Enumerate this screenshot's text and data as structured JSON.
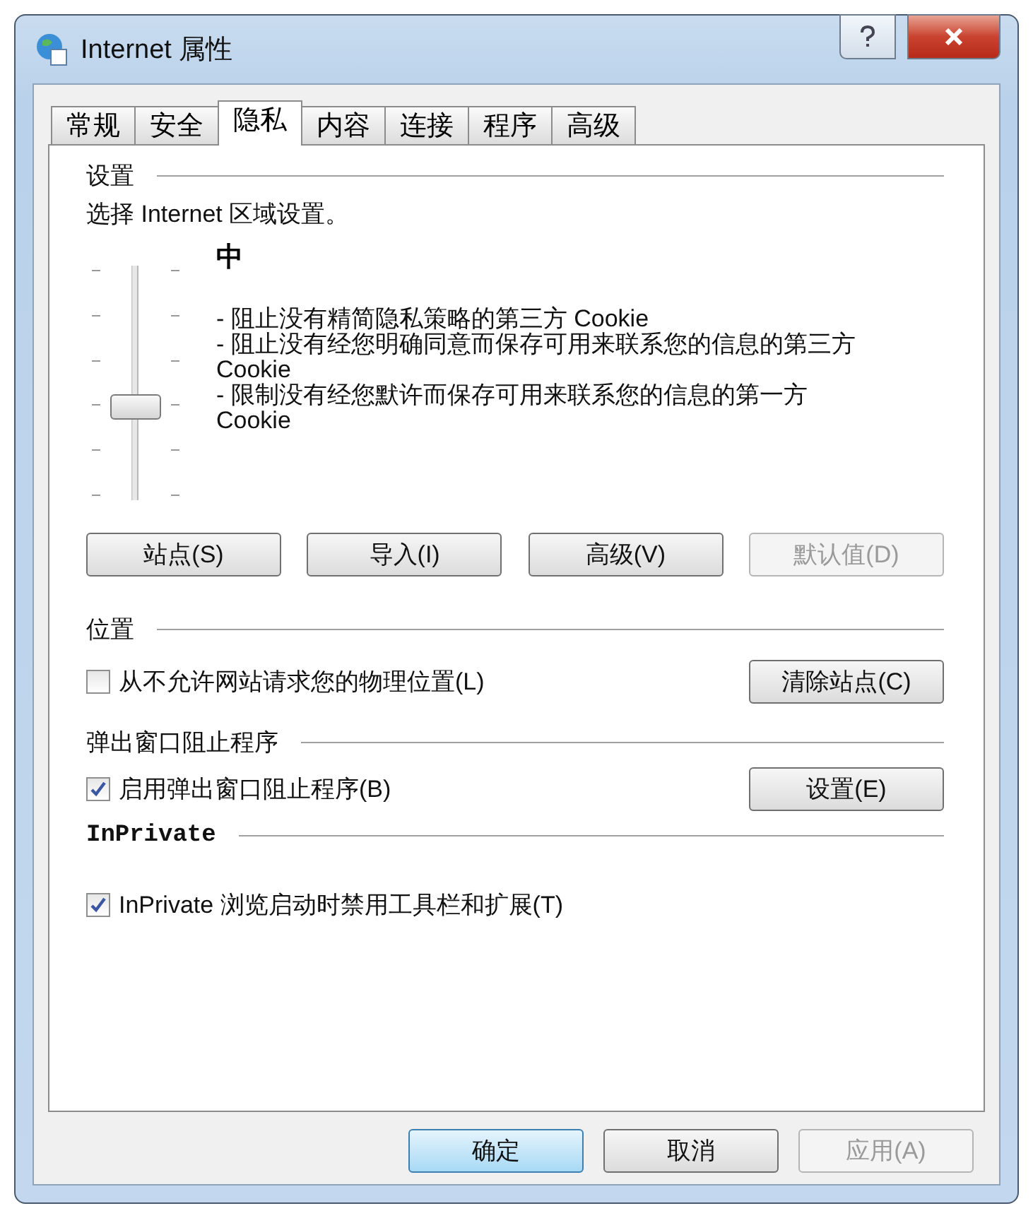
{
  "window": {
    "title": "Internet 属性"
  },
  "tabs": [
    {
      "label": "常规",
      "selected": false
    },
    {
      "label": "安全",
      "selected": false
    },
    {
      "label": "隐私",
      "selected": true
    },
    {
      "label": "内容",
      "selected": false
    },
    {
      "label": "连接",
      "selected": false
    },
    {
      "label": "程序",
      "selected": false
    },
    {
      "label": "高级",
      "selected": false
    }
  ],
  "settings": {
    "heading": "设置",
    "prompt": "选择 Internet 区域设置。",
    "level_name": "中",
    "slider": {
      "level": 0.4
    },
    "description": [
      "- 阻止没有精简隐私策略的第三方 Cookie",
      "- 阻止没有经您明确同意而保存可用来联系您的信息的第三方 Cookie",
      "- 限制没有经您默许而保存可用来联系您的信息的第一方 Cookie"
    ],
    "buttons": [
      {
        "label": "站点(S)",
        "disabled": false
      },
      {
        "label": "导入(I)",
        "disabled": false
      },
      {
        "label": "高级(V)",
        "disabled": false
      },
      {
        "label": "默认值(D)",
        "disabled": true
      }
    ]
  },
  "location": {
    "heading": "位置",
    "checkbox": {
      "label": "从不允许网站请求您的物理位置(L)",
      "checked": false
    },
    "button": {
      "label": "清除站点(C)"
    }
  },
  "popup_blocker": {
    "heading": "弹出窗口阻止程序",
    "checkbox": {
      "label": "启用弹出窗口阻止程序(B)",
      "checked": true
    },
    "button": {
      "label": "设置(E)"
    }
  },
  "inprivate": {
    "heading": "InPrivate",
    "checkbox": {
      "label": "InPrivate 浏览启动时禁用工具栏和扩展(T)",
      "checked": true
    }
  },
  "footer_buttons": [
    {
      "label": "确定",
      "kind": "default",
      "disabled": false
    },
    {
      "label": "取消",
      "kind": "normal",
      "disabled": false
    },
    {
      "label": "应用(A)",
      "kind": "normal",
      "disabled": true
    }
  ]
}
